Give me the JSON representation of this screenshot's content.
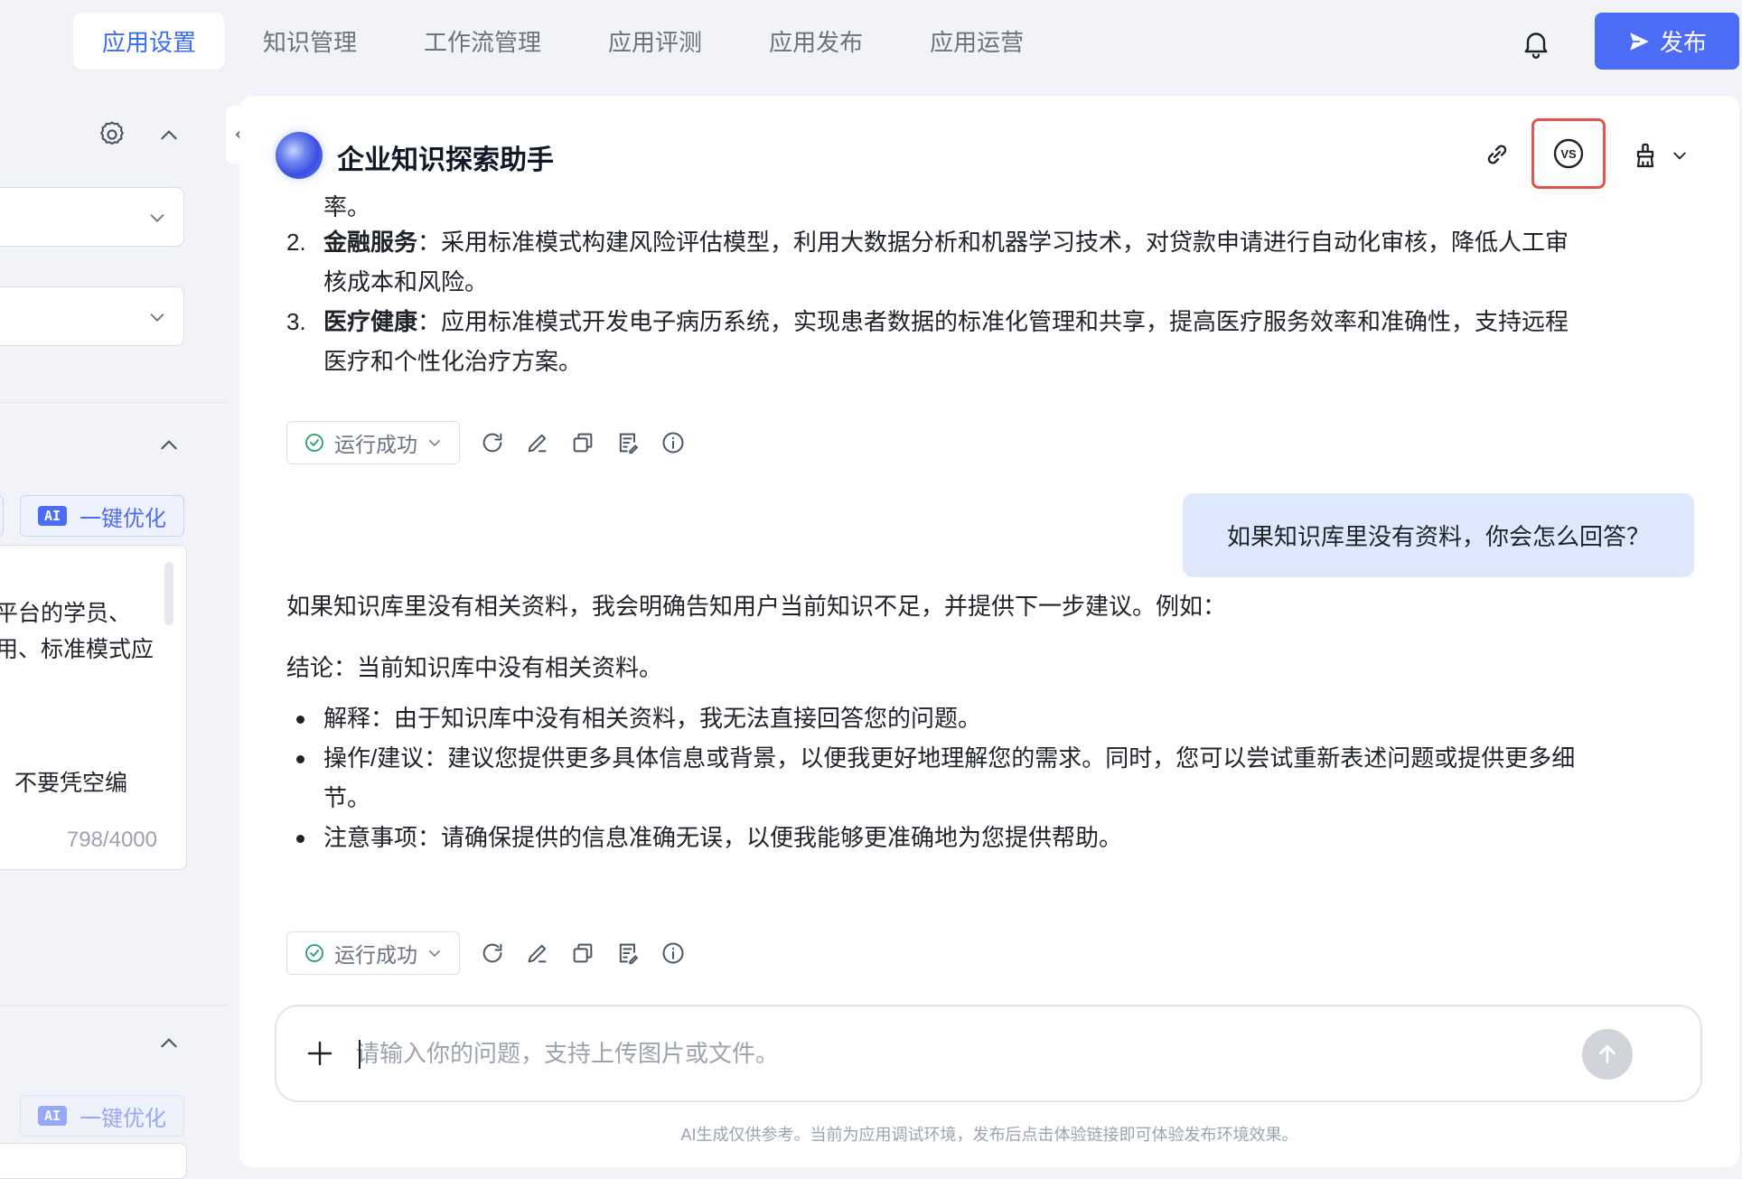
{
  "tabs": [
    {
      "label": "应用设置",
      "active": true
    },
    {
      "label": "知识管理"
    },
    {
      "label": "工作流管理"
    },
    {
      "label": "应用评测"
    },
    {
      "label": "应用发布"
    },
    {
      "label": "应用运营"
    }
  ],
  "header": {
    "publish_label": "发布",
    "accent_color": "#4d6cf5"
  },
  "left_panel": {
    "ai_optimize_label": "一键优化",
    "ai_badge": "AI",
    "prompt_lines": [
      "平台的学员、",
      "用、标准模式应",
      "，不要凭空编"
    ],
    "counter": "798/4000"
  },
  "chat": {
    "title": "企业知识探索助手",
    "message1": {
      "fragment": "率。",
      "items": [
        {
          "num": "2.",
          "bold": "金融服务",
          "sep": "：",
          "lines": [
            "采用标准模式构建风险评估模型，利用大数据分析和机器学习技术，对贷款申请进行自动化审核，降低人工审",
            "核成本和风险。"
          ]
        },
        {
          "num": "3.",
          "bold": "医疗健康",
          "sep": "：",
          "lines": [
            "应用标准模式开发电子病历系统，实现患者数据的标准化管理和共享，提高医疗服务效率和准确性，支持远程",
            "医疗和个性化治疗方案。"
          ]
        }
      ]
    },
    "status_label": "运行成功",
    "user_message": "如果知识库里没有资料，你会怎么回答？",
    "message2": {
      "intro": "如果知识库里没有相关资料，我会明确告知用户当前知识不足，并提供下一步建议。例如：",
      "conclusion": "结论：当前知识库中没有相关资料。",
      "bullets": [
        [
          "解释：由于知识库中没有相关资料，我无法直接回答您的问题。"
        ],
        [
          "操作/建议：建议您提供更多具体信息或背景，以便我更好地理解您的需求。同时，您可以尝试重新表述问题或提供更多细",
          "节。"
        ],
        [
          "注意事项：请确保提供的信息准确无误，以便我能够更准确地为您提供帮助。"
        ]
      ]
    },
    "input_placeholder": "请输入你的问题，支持上传图片或文件。",
    "footer_note": "AI生成仅供参考。当前为应用调试环境，发布后点击体验链接即可体验发布环境效果。",
    "vs_label": "VS",
    "highlight_color": "#e5534b"
  }
}
